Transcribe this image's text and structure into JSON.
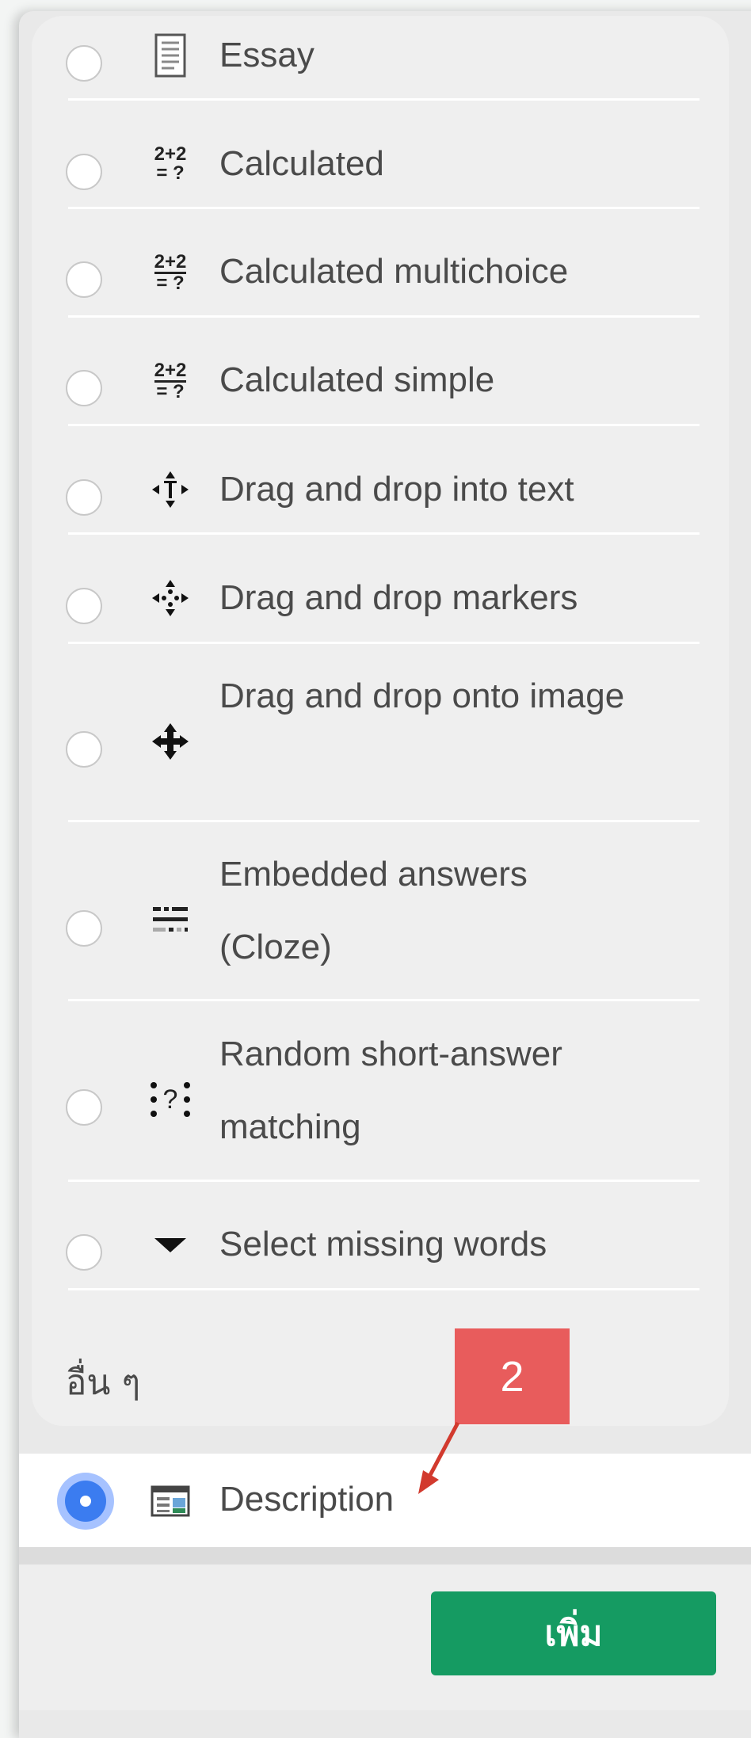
{
  "question_types": [
    {
      "label": "Essay",
      "icon": "essay-icon"
    },
    {
      "label": "Calculated",
      "icon": "calculated-icon",
      "icon_text": [
        "2+2",
        "= ?"
      ]
    },
    {
      "label": "Calculated multichoice",
      "icon": "calculated-multichoice-icon",
      "icon_text": [
        "2+2",
        "= ?"
      ]
    },
    {
      "label": "Calculated simple",
      "icon": "calculated-simple-icon",
      "icon_text": [
        "2+2",
        "= ?"
      ]
    },
    {
      "label": "Drag and drop into text",
      "icon": "drag-drop-text-icon"
    },
    {
      "label": "Drag and drop markers",
      "icon": "drag-drop-markers-icon"
    },
    {
      "label": "Drag and drop onto image",
      "icon": "drag-drop-image-icon"
    },
    {
      "label": "Embedded answers (Cloze)",
      "icon": "cloze-icon"
    },
    {
      "label": "Random short-answer matching",
      "icon": "random-matching-icon",
      "icon_text": [
        "?"
      ]
    },
    {
      "label": "Select missing words",
      "icon": "select-missing-words-icon"
    }
  ],
  "other_section": {
    "heading": "อื่น ๆ",
    "selected_item": {
      "label": "Description",
      "icon": "description-icon"
    }
  },
  "footer": {
    "add_label": "เพิ่ม"
  },
  "annotation": {
    "number": "2"
  },
  "colors": {
    "accent": "#3b7cf0",
    "add_button": "#159b62",
    "callout": "#e85c5c"
  }
}
